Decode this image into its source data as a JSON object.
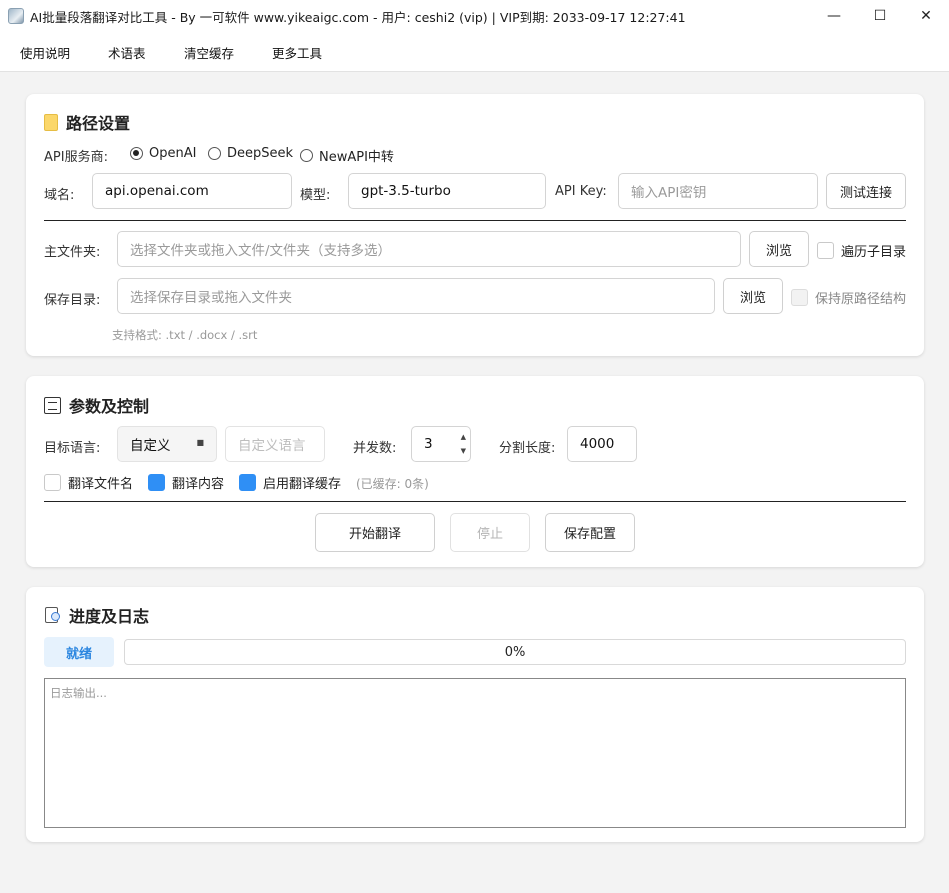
{
  "window": {
    "title": "AI批量段落翻译对比工具 - By 一可软件 www.yikeaigc.com - 用户: ceshi2 (vip) | VIP到期: 2033-09-17 12:27:41",
    "minimize": "—",
    "maximize": "☐",
    "close": "✕"
  },
  "menu": [
    "使用说明",
    "术语表",
    "清空缓存",
    "更多工具"
  ],
  "path_settings": {
    "title": "路径设置",
    "api_provider_label": "API服务商:",
    "providers": [
      {
        "label": "OpenAI",
        "selected": true
      },
      {
        "label": "DeepSeek",
        "selected": false
      },
      {
        "label": "NewAPI中转",
        "selected": false
      }
    ],
    "domain_label": "域名:",
    "domain_value": "api.openai.com",
    "model_label": "模型:",
    "model_value": "gpt-3.5-turbo",
    "apikey_label": "API Key:",
    "apikey_placeholder": "输入API密钥",
    "test_button": "测试连接",
    "main_folder_label": "主文件夹:",
    "main_folder_placeholder": "选择文件夹或拖入文件/文件夹（支持多选）",
    "browse_label": "浏览",
    "recursive_label": "遍历子目录",
    "save_dir_label": "保存目录:",
    "save_dir_placeholder": "选择保存目录或拖入文件夹",
    "keep_structure_label": "保持原路径结构",
    "formats_hint": "支持格式: .txt / .docx / .srt"
  },
  "params": {
    "title": "参数及控制",
    "target_lang_label": "目标语言:",
    "target_lang_value": "自定义",
    "custom_lang_placeholder": "自定义语言",
    "concurrency_label": "并发数:",
    "concurrency_value": "3",
    "split_label": "分割长度:",
    "split_value": "4000",
    "translate_filename_label": "翻译文件名",
    "translate_filename_checked": false,
    "translate_content_label": "翻译内容",
    "translate_content_checked": true,
    "enable_cache_label": "启用翻译缓存",
    "enable_cache_checked": true,
    "cache_count": "(已缓存: 0条)",
    "start_button": "开始翻译",
    "stop_button": "停止",
    "save_config_button": "保存配置"
  },
  "progress": {
    "title": "进度及日志",
    "status": "就绪",
    "percent_text": "0%",
    "percent_value": 0,
    "log_placeholder": "日志输出..."
  },
  "colors": {
    "accent": "#2f8ff5",
    "status_bg": "#e6f2fd"
  }
}
